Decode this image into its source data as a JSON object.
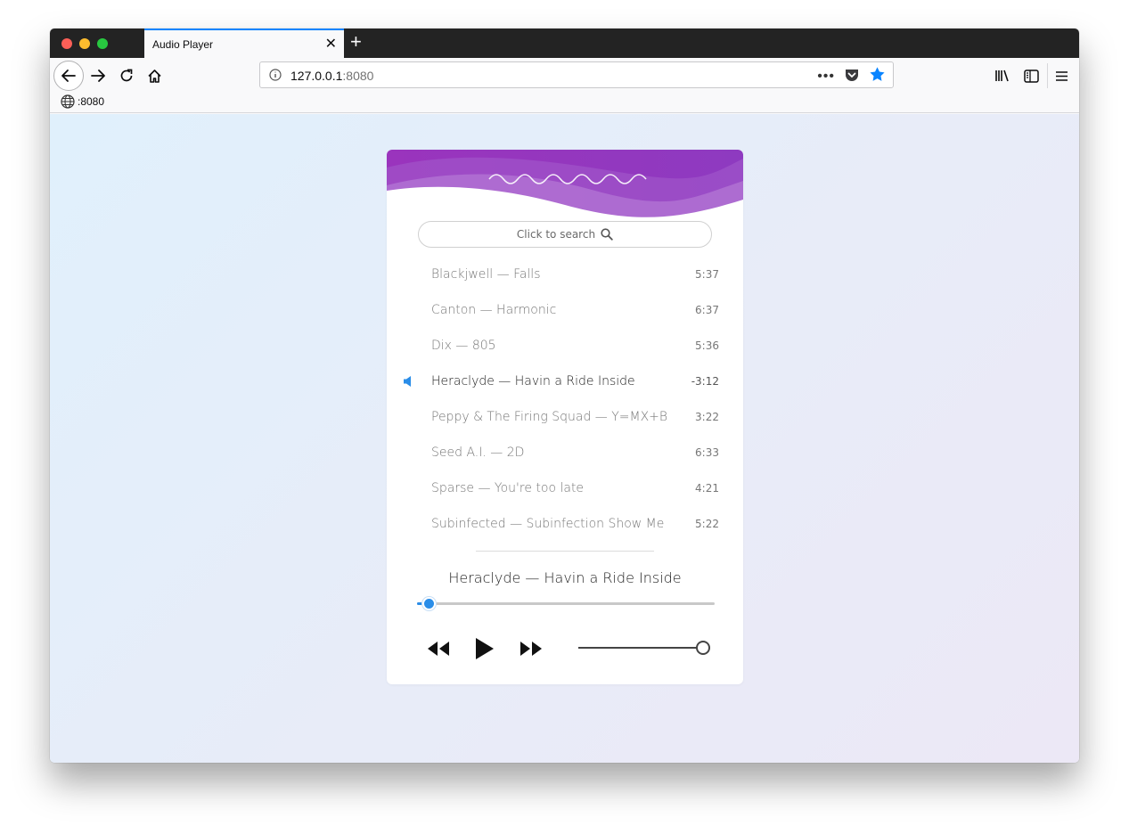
{
  "browser": {
    "tab_title": "Audio Player",
    "url_host": "127.0.0.1",
    "url_port": ":8080",
    "bookmark_label": ":8080",
    "accent": "#0a84ff"
  },
  "player": {
    "search_placeholder": "Click to search",
    "tracks": [
      {
        "title": "Blackjwell — Falls",
        "time": "5:37",
        "active": false
      },
      {
        "title": "Canton — Harmonic",
        "time": "6:37",
        "active": false
      },
      {
        "title": "Dix — 805",
        "time": "5:36",
        "active": false
      },
      {
        "title": "Heraclyde — Havin a Ride Inside",
        "time": "-3:12",
        "active": true
      },
      {
        "title": "Peppy & The Firing Squad — Y=MX+B",
        "time": "3:22",
        "active": false
      },
      {
        "title": "Seed A.I. — 2D",
        "time": "6:33",
        "active": false
      },
      {
        "title": "Sparse — You're too late",
        "time": "4:21",
        "active": false
      },
      {
        "title": "Subinfected — Subinfection Show Me",
        "time": "5:22",
        "active": false
      }
    ],
    "now_playing": "Heraclyde — Havin a Ride Inside",
    "progress_fraction": 0.04,
    "volume_fraction": 1.0,
    "accent_color": "#2a8de8",
    "header_color": "#9b3fc3"
  }
}
